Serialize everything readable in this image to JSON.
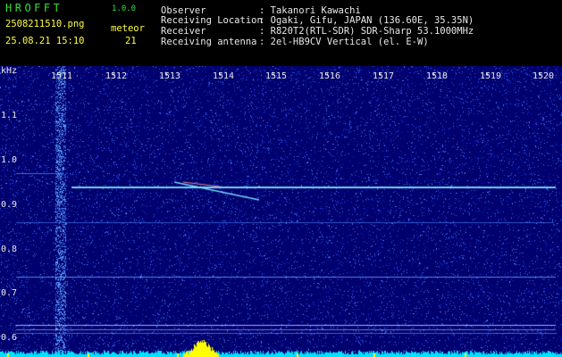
{
  "app": {
    "name": "HROFFT",
    "version": "1.0.0"
  },
  "file": {
    "name": "2508211510.png",
    "datetime": "25.08.21 15:10"
  },
  "counter": {
    "label": "meteor",
    "value": "21"
  },
  "info": [
    {
      "key": "Observer",
      "value": ": Takanori Kawachi"
    },
    {
      "key": "Receiving Location",
      "value": ": Ogaki, Gifu, JAPAN (136.60E, 35.35N)"
    },
    {
      "key": "Receiver",
      "value": ": R820T2(RTL-SDR) SDR-Sharp 53.1000MHz"
    },
    {
      "key": "Receiving antenna",
      "value": ": 2el-HB9CV Vertical (el. E-W)"
    }
  ],
  "yaxis": {
    "unit": "kHz",
    "ticks": [
      "1.1",
      "1.0",
      "0.9",
      "0.8",
      "0.7",
      "0.6"
    ]
  },
  "xaxis": {
    "ticks": [
      "1511",
      "1512",
      "1513",
      "1514",
      "1515",
      "1516",
      "1517",
      "1518",
      "1519",
      "1520"
    ]
  },
  "colors": {
    "background": "#00006e",
    "signal": "#7fe8ff",
    "noise": "#3c70ff",
    "baseline": "#00e0ff",
    "burst": "#ffff00",
    "title": "#35e03a",
    "counter": "#ffff3c"
  }
}
